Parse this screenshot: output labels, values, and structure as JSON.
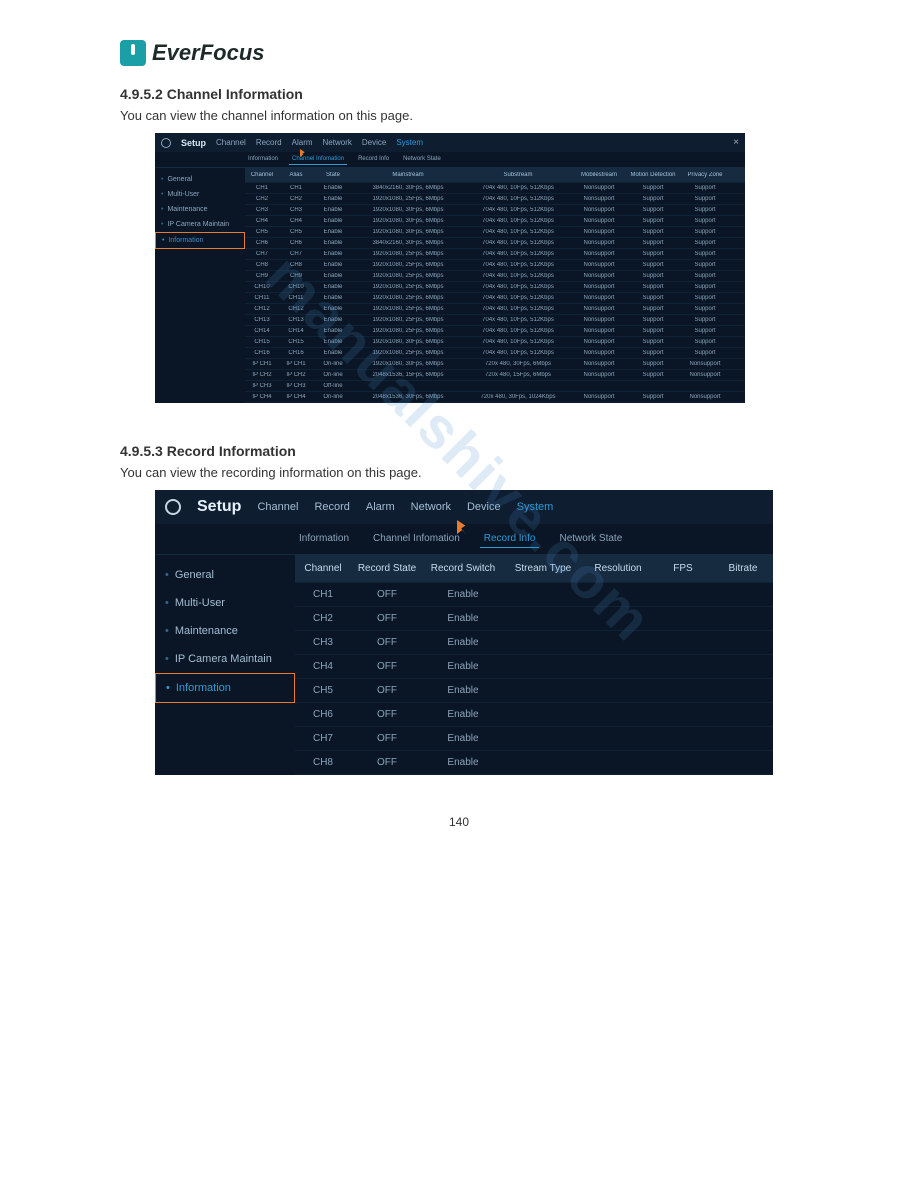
{
  "logo_text": "EverFocus",
  "section1": {
    "number": "4.9.5.2",
    "title": "Channel Information",
    "body": "You can view the channel information on this page."
  },
  "section2": {
    "number": "4.9.5.3",
    "title": "Record Information",
    "body": "You can view the recording information on this page."
  },
  "page_num": "140",
  "watermark": "manualshive.com",
  "top_tabs": [
    "Channel",
    "Record",
    "Alarm",
    "Network",
    "Device",
    "System"
  ],
  "top_active": "System",
  "sub_tabs1": [
    "Information",
    "Channel Infomation",
    "Record Info",
    "Network State"
  ],
  "sub_active1": "Channel Infomation",
  "sub_tabs2": [
    "Information",
    "Channel Infomation",
    "Record Info",
    "Network State"
  ],
  "sub_active2": "Record Info",
  "setup_label": "Setup",
  "sidebar": [
    "General",
    "Multi-User",
    "Maintenance",
    "IP Camera Maintain",
    "Information"
  ],
  "sidebar_active": "Information",
  "table1_headers": [
    "Channel",
    "Alias",
    "State",
    "Mainstream",
    "Substream",
    "Mobilestream",
    "Motion Detection",
    "Privacy Zone"
  ],
  "table1_rows": [
    [
      "CH1",
      "CH1",
      "Enable",
      "3840x2160, 30Fps, 6Mbps",
      "704x 480, 10Fps, 512Kbps",
      "Nonsupport",
      "Support",
      "Support"
    ],
    [
      "CH2",
      "CH2",
      "Enable",
      "1920x1080, 25Fps, 6Mbps",
      "704x 480, 10Fps, 512Kbps",
      "Nonsupport",
      "Support",
      "Support"
    ],
    [
      "CH3",
      "CH3",
      "Enable",
      "1920x1080, 30Fps, 6Mbps",
      "704x 480, 10Fps, 512Kbps",
      "Nonsupport",
      "Support",
      "Support"
    ],
    [
      "CH4",
      "CH4",
      "Enable",
      "1920x1080, 30Fps, 6Mbps",
      "704x 480, 10Fps, 512Kbps",
      "Nonsupport",
      "Support",
      "Support"
    ],
    [
      "CH5",
      "CH5",
      "Enable",
      "1920x1080, 30Fps, 6Mbps",
      "704x 480, 10Fps, 512Kbps",
      "Nonsupport",
      "Support",
      "Support"
    ],
    [
      "CH6",
      "CH6",
      "Enable",
      "3840x2160, 30Fps, 6Mbps",
      "704x 480, 10Fps, 512Kbps",
      "Nonsupport",
      "Support",
      "Support"
    ],
    [
      "CH7",
      "CH7",
      "Enable",
      "1920x1080, 25Fps, 6Mbps",
      "704x 480, 10Fps, 512Kbps",
      "Nonsupport",
      "Support",
      "Support"
    ],
    [
      "CH8",
      "CH8",
      "Enable",
      "1920x1080, 25Fps, 6Mbps",
      "704x 480, 10Fps, 512Kbps",
      "Nonsupport",
      "Support",
      "Support"
    ],
    [
      "CH9",
      "CH9",
      "Enable",
      "1920x1080, 25Fps, 6Mbps",
      "704x 480, 10Fps, 512Kbps",
      "Nonsupport",
      "Support",
      "Support"
    ],
    [
      "CH10",
      "CH10",
      "Enable",
      "1920x1080, 25Fps, 6Mbps",
      "704x 480, 10Fps, 512Kbps",
      "Nonsupport",
      "Support",
      "Support"
    ],
    [
      "CH11",
      "CH11",
      "Enable",
      "1920x1080, 25Fps, 6Mbps",
      "704x 480, 10Fps, 512Kbps",
      "Nonsupport",
      "Support",
      "Support"
    ],
    [
      "CH12",
      "CH12",
      "Enable",
      "1920x1080, 25Fps, 6Mbps",
      "704x 480, 10Fps, 512Kbps",
      "Nonsupport",
      "Support",
      "Support"
    ],
    [
      "CH13",
      "CH13",
      "Enable",
      "1920x1080, 25Fps, 6Mbps",
      "704x 480, 10Fps, 512Kbps",
      "Nonsupport",
      "Support",
      "Support"
    ],
    [
      "CH14",
      "CH14",
      "Enable",
      "1920x1080, 25Fps, 6Mbps",
      "704x 480, 10Fps, 512Kbps",
      "Nonsupport",
      "Support",
      "Support"
    ],
    [
      "CH15",
      "CH15",
      "Enable",
      "1920x1080, 30Fps, 6Mbps",
      "704x 480, 10Fps, 512Kbps",
      "Nonsupport",
      "Support",
      "Support"
    ],
    [
      "CH16",
      "CH16",
      "Enable",
      "1920x1080, 25Fps, 6Mbps",
      "704x 480, 10Fps, 512Kbps",
      "Nonsupport",
      "Support",
      "Support"
    ],
    [
      "IP CH1",
      "IP CH1",
      "On-line",
      "1920x1080, 30Fps, 6Mbps",
      "720x 480, 30Fps, 6Mbps",
      "Nonsupport",
      "Support",
      "Nonsupport"
    ],
    [
      "IP CH2",
      "IP CH2",
      "On-line",
      "2048x1536, 15Fps, 6Mbps",
      "720x 480, 15Fps, 6Mbps",
      "Nonsupport",
      "Support",
      "Nonsupport"
    ],
    [
      "IP CH3",
      "IP CH3",
      "Off-line",
      "",
      "",
      "",
      "",
      ""
    ],
    [
      "IP CH4",
      "IP CH4",
      "On-line",
      "2048x1536, 30Fps, 6Mbps",
      "720x 480, 30Fps, 1024Kbps",
      "Nonsupport",
      "Support",
      "Nonsupport"
    ]
  ],
  "table2_headers": [
    "Channel",
    "Record State",
    "Record Switch",
    "Stream Type",
    "Resolution",
    "FPS",
    "Bitrate"
  ],
  "table2_rows": [
    [
      "CH1",
      "OFF",
      "Enable",
      "",
      "",
      "",
      ""
    ],
    [
      "CH2",
      "OFF",
      "Enable",
      "",
      "",
      "",
      ""
    ],
    [
      "CH3",
      "OFF",
      "Enable",
      "",
      "",
      "",
      ""
    ],
    [
      "CH4",
      "OFF",
      "Enable",
      "",
      "",
      "",
      ""
    ],
    [
      "CH5",
      "OFF",
      "Enable",
      "",
      "",
      "",
      ""
    ],
    [
      "CH6",
      "OFF",
      "Enable",
      "",
      "",
      "",
      ""
    ],
    [
      "CH7",
      "OFF",
      "Enable",
      "",
      "",
      "",
      ""
    ],
    [
      "CH8",
      "OFF",
      "Enable",
      "",
      "",
      "",
      ""
    ]
  ]
}
